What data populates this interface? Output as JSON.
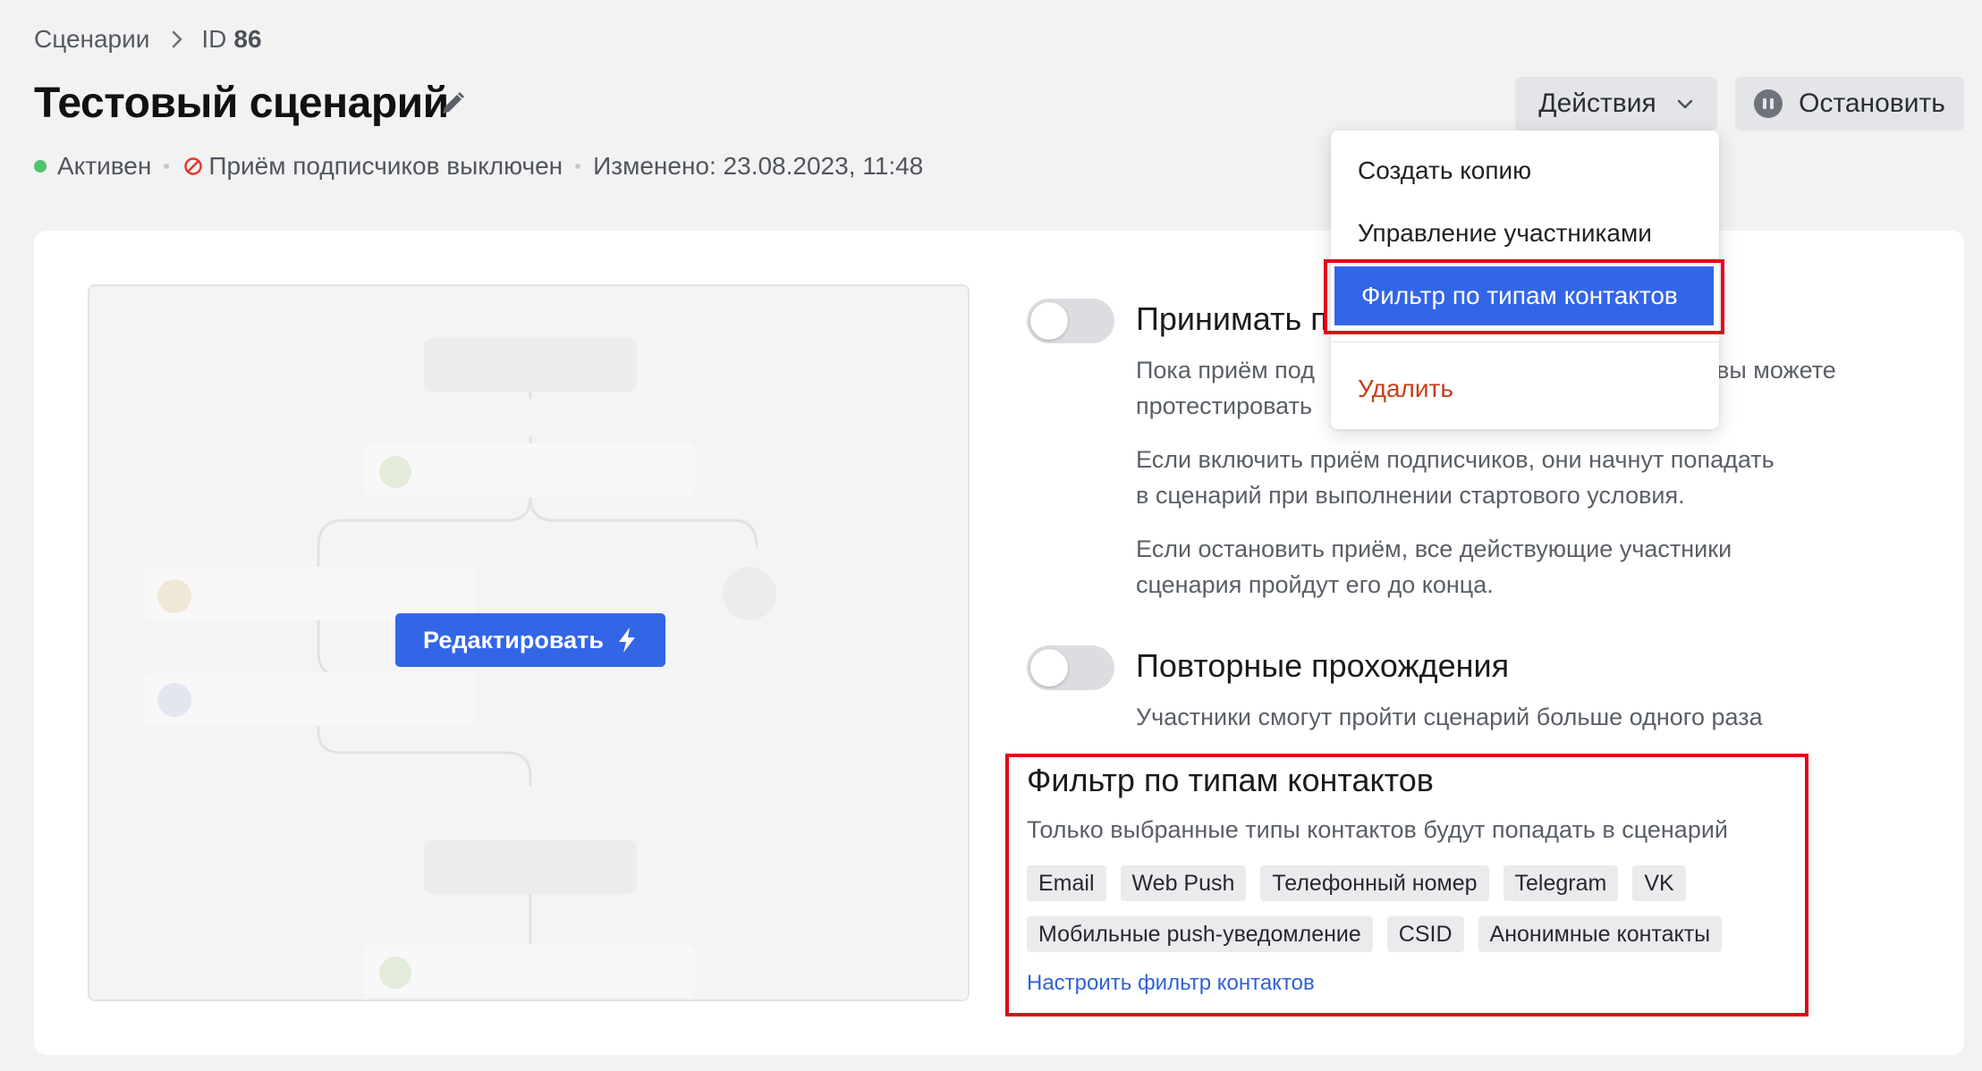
{
  "breadcrumb": {
    "root": "Сценарии",
    "id_label": "ID",
    "id_value": "86"
  },
  "title": "Тестовый сценарий",
  "status": {
    "active": "Активен",
    "subscribers": "Приём подписчиков выключен",
    "modified": "Изменено: 23.08.2023, 11:48"
  },
  "header": {
    "actions_label": "Действия",
    "stop_label": "Остановить"
  },
  "preview": {
    "edit_label": "Редактировать"
  },
  "settings": {
    "accept": {
      "title": "Принимать п",
      "desc_line1": "Пока приём под",
      "desc_line1_tail": ", вы можете",
      "desc_line2": "протестировать",
      "para2_line1": "Если включить приём подписчиков, они начнут попадать",
      "para2_line2": "в сценарий при выполнении стартового условия.",
      "para3_line1": "Если остановить приём, все действующие участники",
      "para3_line2": "сценария пройдут его до конца."
    },
    "repeat": {
      "title": "Повторные прохождения",
      "desc": "Участники смогут пройти сценарий больше одного раза"
    }
  },
  "filter": {
    "title": "Фильтр по типам контактов",
    "subtitle": "Только выбранные типы контактов будут попадать в сценарий",
    "chips_row1": [
      "Email",
      "Web Push",
      "Телефонный номер",
      "Telegram",
      "VK"
    ],
    "chips_row2": [
      "Мобильные push-уведомление",
      "CSID",
      "Анонимные контакты"
    ],
    "configure_link": "Настроить фильтр контактов"
  },
  "dropdown": {
    "copy": "Создать копию",
    "participants": "Управление участниками",
    "filter": "Фильтр по типам контактов",
    "delete": "Удалить"
  },
  "colors": {
    "accent": "#3366e6",
    "active_dot": "#4fc46b",
    "danger": "#c63d18",
    "highlight": "#e1001a"
  },
  "toggles": {
    "accept_enabled": false,
    "repeat_enabled": false
  }
}
